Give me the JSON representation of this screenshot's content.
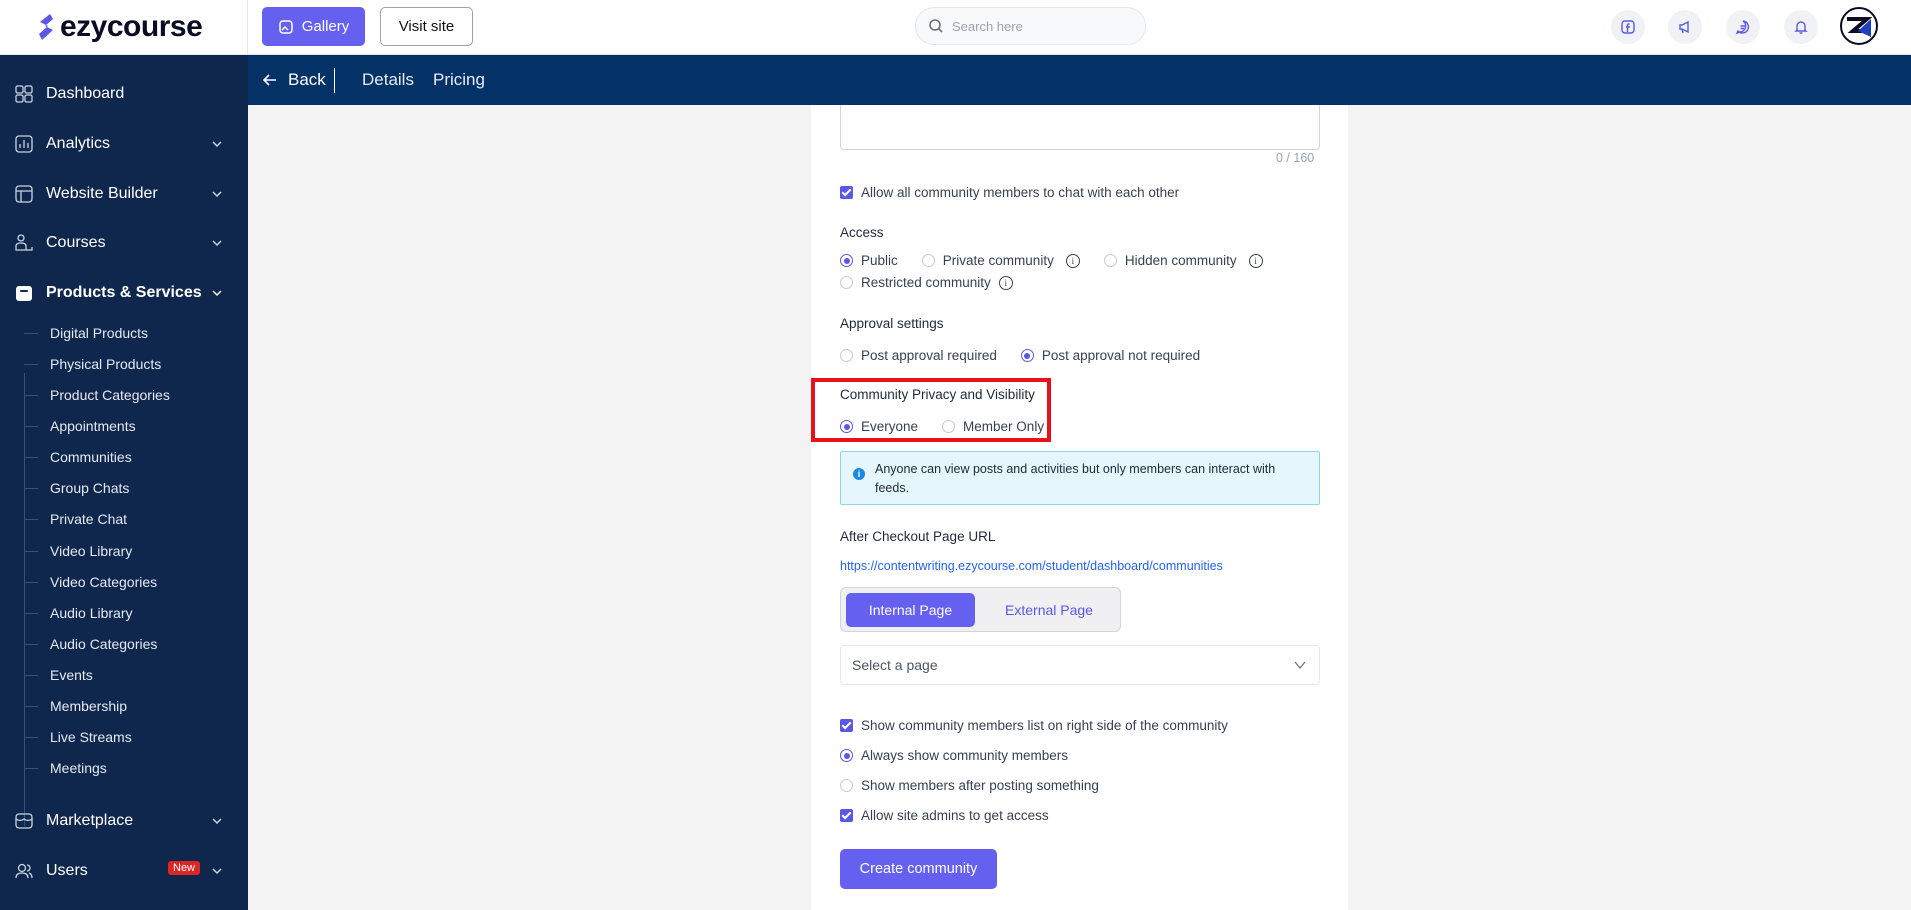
{
  "app": {
    "brand": "ezycourse"
  },
  "topbar": {
    "gallery_label": "Gallery",
    "visit_site_label": "Visit site",
    "search_placeholder": "Search here"
  },
  "sidebar": {
    "items": [
      {
        "label": "Dashboard",
        "icon": "dashboard-icon"
      },
      {
        "label": "Analytics",
        "icon": "analytics-icon"
      },
      {
        "label": "Website Builder",
        "icon": "website-builder-icon"
      },
      {
        "label": "Courses",
        "icon": "courses-icon"
      },
      {
        "label": "Products & Services",
        "icon": "products-icon"
      },
      {
        "label": "Marketplace",
        "icon": "marketplace-icon"
      },
      {
        "label": "Users",
        "icon": "users-icon",
        "badge": "New"
      }
    ],
    "sub_items": [
      "Digital Products",
      "Physical Products",
      "Product Categories",
      "Appointments",
      "Communities",
      "Group Chats",
      "Private Chat",
      "Video Library",
      "Video Categories",
      "Audio Library",
      "Audio Categories",
      "Events",
      "Membership",
      "Live Streams",
      "Meetings"
    ]
  },
  "subheader": {
    "back_label": "Back",
    "tabs": [
      "Details",
      "Pricing"
    ]
  },
  "form": {
    "char_count": "0 / 160",
    "allow_chat_label": "Allow all community members to chat with each other",
    "access": {
      "title": "Access",
      "options": [
        "Public",
        "Private community",
        "Hidden community",
        "Restricted community"
      ],
      "selected": "Public"
    },
    "approval": {
      "title": "Approval settings",
      "options": [
        "Post approval required",
        "Post approval not required"
      ],
      "selected": "Post approval not required"
    },
    "privacy": {
      "title": "Community Privacy and Visibility",
      "options": [
        "Everyone",
        "Member Only"
      ],
      "selected": "Everyone",
      "info": "Anyone can view posts and activities but only members can interact with feeds."
    },
    "after_checkout": {
      "title": "After Checkout Page URL",
      "url": "https://contentwriting.ezycourse.com/student/dashboard/communities",
      "internal_label": "Internal Page",
      "external_label": "External Page",
      "select_placeholder": "Select a page"
    },
    "show_members_label": "Show community members list on right side of the community",
    "always_show_label": "Always show community members",
    "show_after_post_label": "Show members after posting something",
    "allow_admins_label": "Allow site admins to get access",
    "create_label": "Create community"
  },
  "colors": {
    "accent": "#6560f0",
    "sidebar": "#0f274d",
    "subheader": "#043166",
    "highlight": "#e8111a"
  }
}
